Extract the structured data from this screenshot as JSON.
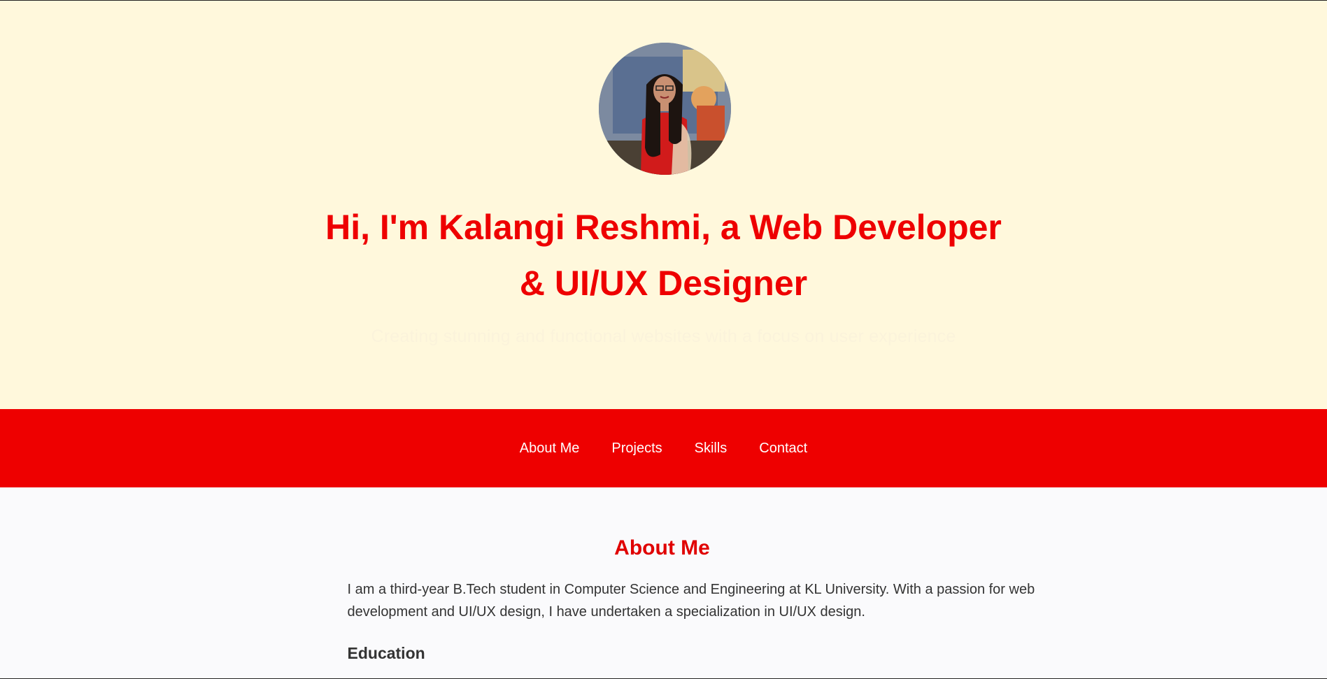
{
  "hero": {
    "title_line1": "Hi, I'm Kalangi Reshmi, a Web Developer",
    "title_line2": "& UI/UX Designer",
    "subtitle": "Creating stunning and functional websites with a focus on user experience"
  },
  "nav": {
    "items": [
      "About Me",
      "Projects",
      "Skills",
      "Contact"
    ]
  },
  "about": {
    "heading": "About Me",
    "paragraph": "I am a third-year B.Tech student in Computer Science and Engineering at KL University. With a passion for web development and UI/UX design, I have undertaken a specialization in UI/UX design.",
    "education_heading": "Education"
  },
  "colors": {
    "accent": "#ee0000",
    "hero_bg": "#fff8dc",
    "content_bg": "#fafafc",
    "text": "#333333"
  }
}
